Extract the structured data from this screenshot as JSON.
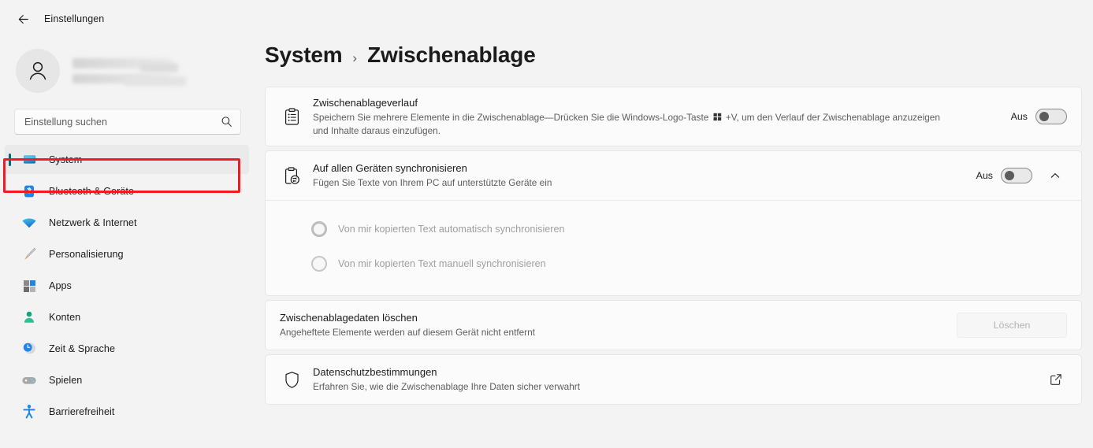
{
  "window": {
    "back_icon": "back-arrow-icon",
    "title": "Einstellungen"
  },
  "account": {
    "avatar_icon": "person-avatar-icon",
    "name_redacted": true
  },
  "search": {
    "placeholder": "Einstellung suchen",
    "value": "",
    "icon": "search-icon"
  },
  "sidebar": {
    "items": [
      {
        "label": "System",
        "icon": "monitor-icon",
        "selected": true
      },
      {
        "label": "Bluetooth & Geräte",
        "icon": "bluetooth-icon",
        "selected": false
      },
      {
        "label": "Netzwerk & Internet",
        "icon": "wifi-icon",
        "selected": false
      },
      {
        "label": "Personalisierung",
        "icon": "brush-icon",
        "selected": false
      },
      {
        "label": "Apps",
        "icon": "apps-grid-icon",
        "selected": false
      },
      {
        "label": "Konten",
        "icon": "person-icon",
        "selected": false
      },
      {
        "label": "Zeit & Sprache",
        "icon": "clock-globe-icon",
        "selected": false
      },
      {
        "label": "Spielen",
        "icon": "gamepad-icon",
        "selected": false
      },
      {
        "label": "Barrierefreiheit",
        "icon": "accessibility-icon",
        "selected": false
      }
    ]
  },
  "breadcrumb": {
    "root": "System",
    "separator": "›",
    "leaf": "Zwischenablage"
  },
  "settings": {
    "clipboard_history": {
      "icon": "clipboard-list-icon",
      "title": "Zwischenablageverlauf",
      "description_part1": "Speichern Sie mehrere Elemente in die Zwischenablage—Drücken Sie die Windows-Logo-Taste",
      "win_key_glyph": "windows-logo-icon",
      "description_part2": "+V, um den Verlauf der Zwischenablage anzuzeigen und Inhalte daraus einzufügen.",
      "toggle_label": "Aus",
      "toggle_state": "off",
      "highlighted": true
    },
    "sync_devices": {
      "icon": "clipboard-sync-icon",
      "title": "Auf allen Geräten synchronisieren",
      "description": "Fügen Sie Texte von Ihrem PC auf unterstützte Geräte ein",
      "toggle_label": "Aus",
      "toggle_state": "off",
      "expand_icon": "chevron-up-icon",
      "expanded": true,
      "options": [
        {
          "label": "Von mir kopierten Text automatisch synchronisieren",
          "selected": false,
          "disabled": true
        },
        {
          "label": "Von mir kopierten Text manuell synchronisieren",
          "selected": false,
          "disabled": true
        }
      ]
    },
    "clear_data": {
      "title": "Zwischenablagedaten löschen",
      "description": "Angeheftete Elemente werden auf diesem Gerät nicht entfernt",
      "button_label": "Löschen",
      "button_disabled": true
    },
    "privacy": {
      "icon": "shield-icon",
      "title": "Datenschutzbestimmungen",
      "description": "Erfahren Sie, wie die Zwischenablage Ihre Daten sicher verwahrt",
      "external_link_icon": "external-link-icon"
    }
  },
  "colors": {
    "accent_teal": "#00687d",
    "highlight_red": "#ee1c24",
    "page_bg": "#f3f3f3",
    "card_bg": "#fbfbfb",
    "text_primary": "#1b1b1b",
    "text_secondary": "#5d5d5d"
  }
}
